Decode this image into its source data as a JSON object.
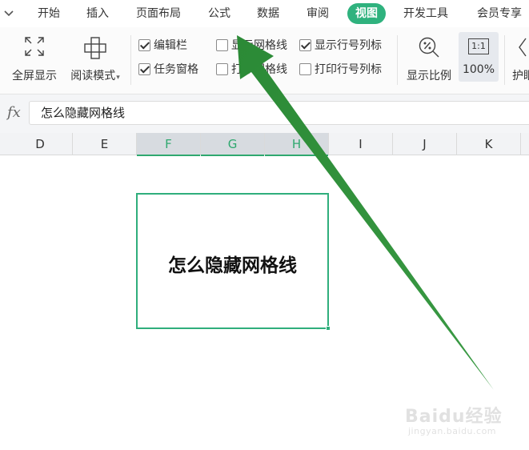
{
  "menubar": {
    "tabs": [
      {
        "label": "开始"
      },
      {
        "label": "插入"
      },
      {
        "label": "页面布局"
      },
      {
        "label": "公式"
      },
      {
        "label": "数据"
      },
      {
        "label": "审阅"
      },
      {
        "label": "视图",
        "active": true
      },
      {
        "label": "开发工具"
      },
      {
        "label": "会员专享"
      }
    ]
  },
  "ribbon": {
    "fullscreen_label": "全屏显示",
    "reading_mode_label": "阅读模式",
    "checkboxes": {
      "edit_bar": {
        "label": "编辑栏",
        "checked": true
      },
      "task_pane": {
        "label": "任务窗格",
        "checked": true
      },
      "show_gridlines": {
        "label": "显示网格线",
        "checked": false
      },
      "print_gridlines": {
        "label": "打印网格线",
        "checked": false
      },
      "show_row_col_headers": {
        "label": "显示行号列标",
        "checked": true
      },
      "print_row_col_headers": {
        "label": "打印行号列标",
        "checked": false
      }
    },
    "zoom_ratio_label": "显示比例",
    "zoom_icon_text": "1:1",
    "zoom_100_label": "100%",
    "protect_partial_label": "护眼"
  },
  "formula_bar": {
    "fx_label": "fx",
    "value": "怎么隐藏网格线"
  },
  "columns": [
    "D",
    "E",
    "F",
    "G",
    "H",
    "I",
    "J",
    "K"
  ],
  "selected_columns": [
    "F",
    "G",
    "H"
  ],
  "cell": {
    "text": "怎么隐藏网格线"
  },
  "colors": {
    "accent": "#2fb27e",
    "arrow": "#2e8b3a"
  },
  "watermark": {
    "main": "Baidu经验",
    "sub": "jingyan.baidu.com"
  }
}
